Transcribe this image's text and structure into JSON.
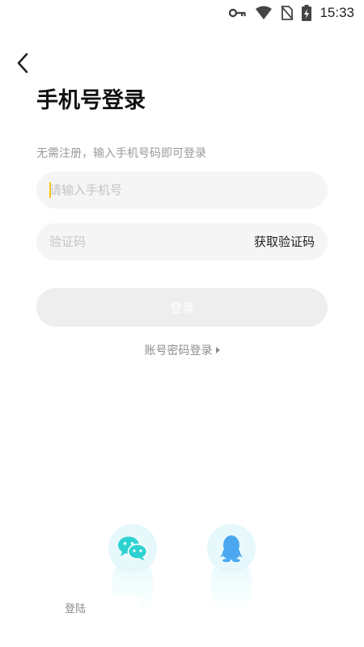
{
  "status_bar": {
    "time": "15:33",
    "icons": [
      "key-icon",
      "wifi-icon",
      "no-sim-icon",
      "battery-charging-icon"
    ]
  },
  "nav": {
    "back_icon": "chevron-left-icon"
  },
  "header": {
    "title": "手机号登录",
    "subtitle": "无需注册，输入手机号码即可登录"
  },
  "form": {
    "phone_placeholder": "请输入手机号",
    "phone_value": "",
    "code_placeholder": "验证码",
    "code_value": "",
    "get_code_label": "获取验证码",
    "login_label": "登录"
  },
  "alt_login": {
    "label": "账号密码登录"
  },
  "social": {
    "wechat_icon": "wechat-icon",
    "qq_icon": "qq-icon"
  },
  "footer": {
    "agreement_text": "登陆"
  },
  "colors": {
    "accent_caret": "#f5c518",
    "wechat": "#2ed3d1",
    "qq": "#4aa7f0",
    "field_bg": "#f5f5f5",
    "button_disabled": "#eeeeee"
  }
}
